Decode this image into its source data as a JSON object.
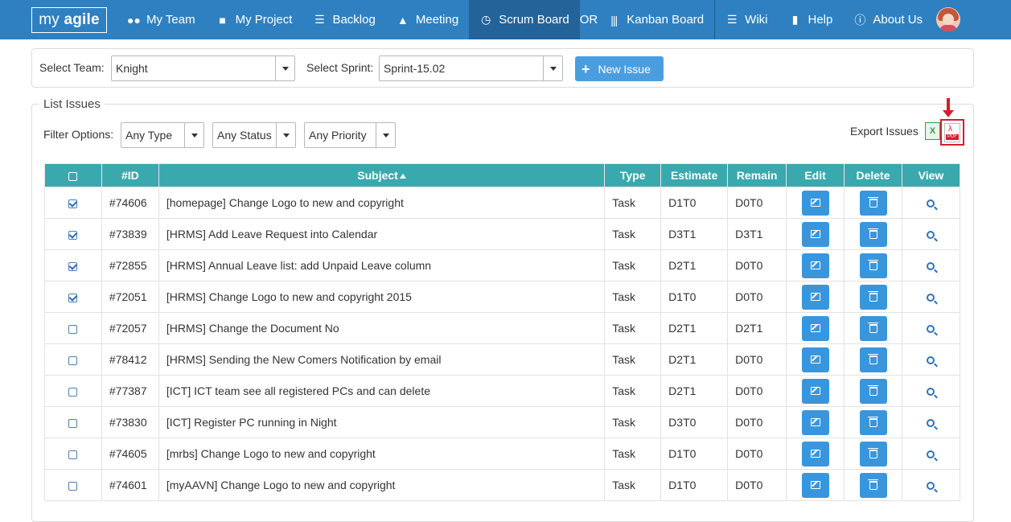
{
  "nav": {
    "brand_prefix": "my",
    "brand_bold": "agile",
    "items": [
      {
        "label": "My Team",
        "icon": "users-icon"
      },
      {
        "label": "My Project",
        "icon": "folder-icon"
      },
      {
        "label": "Backlog",
        "icon": "list-icon"
      },
      {
        "label": "Meeting",
        "icon": "sitemap-icon"
      },
      {
        "label": "Scrum Board",
        "icon": "clock-icon"
      },
      {
        "label": "OR"
      },
      {
        "label": "Kanban Board",
        "icon": "columns-icon"
      },
      {
        "label": "Wiki",
        "icon": "list-alt-icon"
      },
      {
        "label": "Help",
        "icon": "book-icon"
      },
      {
        "label": "About Us",
        "icon": "info-icon"
      }
    ]
  },
  "selectors": {
    "team_label": "Select Team:",
    "team_value": "Knight",
    "sprint_label": "Select Sprint:",
    "sprint_value": "Sprint-15.02",
    "new_issue_label": "New Issue"
  },
  "list": {
    "legend": "List Issues",
    "filter_label": "Filter Options:",
    "filters": [
      "Any Type",
      "Any Status",
      "Any Priority"
    ],
    "export_label": "Export Issues",
    "pdf_tag": "PDF",
    "xls_tag": "X"
  },
  "table": {
    "headers": [
      "#ID",
      "Subject",
      "Type",
      "Estimate",
      "Remain",
      "Edit",
      "Delete",
      "View"
    ],
    "rows": [
      {
        "checked": true,
        "id": "#74606",
        "subject": "[homepage] Change Logo to new and copyright",
        "type": "Task",
        "estimate": "D1T0",
        "remain": "D0T0"
      },
      {
        "checked": true,
        "id": "#73839",
        "subject": "[HRMS] Add Leave Request into Calendar",
        "type": "Task",
        "estimate": "D3T1",
        "remain": "D3T1"
      },
      {
        "checked": true,
        "id": "#72855",
        "subject": "[HRMS] Annual Leave list: add Unpaid Leave column",
        "type": "Task",
        "estimate": "D2T1",
        "remain": "D0T0"
      },
      {
        "checked": true,
        "id": "#72051",
        "subject": "[HRMS] Change Logo to new and copyright 2015",
        "type": "Task",
        "estimate": "D1T0",
        "remain": "D0T0"
      },
      {
        "checked": false,
        "id": "#72057",
        "subject": "[HRMS] Change the Document No",
        "type": "Task",
        "estimate": "D2T1",
        "remain": "D2T1"
      },
      {
        "checked": false,
        "id": "#78412",
        "subject": "[HRMS] Sending the New Comers Notification by email",
        "type": "Task",
        "estimate": "D2T1",
        "remain": "D0T0"
      },
      {
        "checked": false,
        "id": "#77387",
        "subject": "[ICT] ICT team see all registered PCs and can delete",
        "type": "Task",
        "estimate": "D2T1",
        "remain": "D0T0"
      },
      {
        "checked": false,
        "id": "#73830",
        "subject": "[ICT] Register PC running in Night",
        "type": "Task",
        "estimate": "D3T0",
        "remain": "D0T0"
      },
      {
        "checked": false,
        "id": "#74605",
        "subject": "[mrbs] Change Logo to new and copyright",
        "type": "Task",
        "estimate": "D1T0",
        "remain": "D0T0"
      },
      {
        "checked": false,
        "id": "#74601",
        "subject": "[myAAVN] Change Logo to new and copyright",
        "type": "Task",
        "estimate": "D1T0",
        "remain": "D0T0"
      }
    ]
  },
  "colors": {
    "navbar": "#2f80c0",
    "navbar_active": "#23639a",
    "table_header": "#3aa9ad",
    "button": "#3996dc",
    "highlight": "#d21f2c"
  }
}
